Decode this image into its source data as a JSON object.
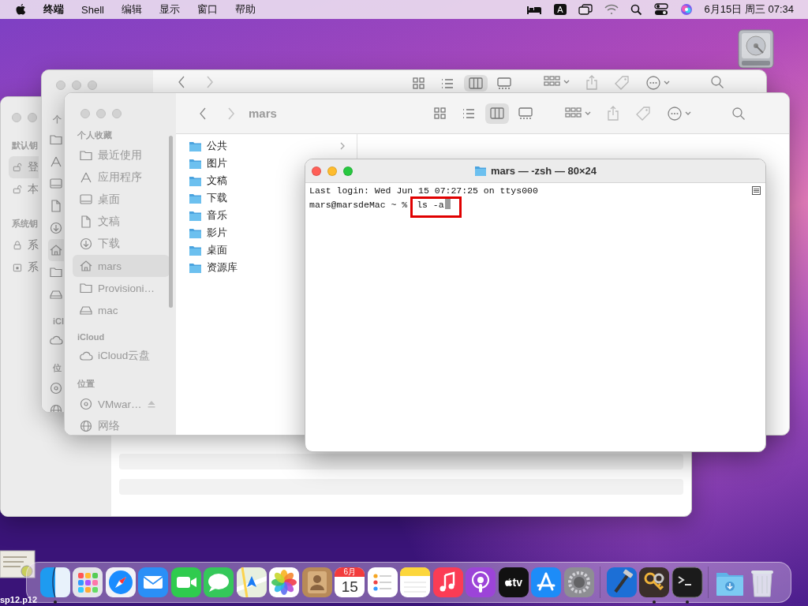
{
  "menu_bar": {
    "app": "终端",
    "menus": [
      "Shell",
      "编辑",
      "显示",
      "窗口",
      "帮助"
    ],
    "input_method": "A",
    "clock": "6月15日 周三 07:34"
  },
  "desktop_icons": [
    {
      "kind": "drive"
    },
    {
      "kind": "certificate",
      "label": "sp12.p12"
    }
  ],
  "keychain_window": {
    "focused": false,
    "sections": [
      {
        "header": "默认钥",
        "items": [
          {
            "kind": "unlocked",
            "label": "登",
            "selected": true
          },
          {
            "kind": "unlocked",
            "label": "本",
            "selected": false
          }
        ]
      },
      {
        "header": "系统钥",
        "items": [
          {
            "kind": "locked",
            "label": "系",
            "selected": false
          },
          {
            "kind": "cabinet",
            "label": "系",
            "selected": false
          }
        ]
      }
    ]
  },
  "back_finder": {
    "focused": false,
    "view_modes": [
      {
        "kind": "icons",
        "selected": false
      },
      {
        "kind": "list",
        "selected": false
      },
      {
        "kind": "columns",
        "selected": true
      },
      {
        "kind": "gallery",
        "selected": false
      }
    ],
    "sidebar": [
      {
        "header": "个",
        "items": [
          {
            "kind": "folder",
            "selected": false
          },
          {
            "kind": "apps",
            "selected": false
          },
          {
            "kind": "desktop",
            "selected": false
          },
          {
            "kind": "doc",
            "selected": false
          },
          {
            "kind": "download",
            "selected": false
          },
          {
            "kind": "home",
            "selected": true
          },
          {
            "kind": "folder",
            "selected": false
          },
          {
            "kind": "drive",
            "selected": false
          }
        ]
      },
      {
        "header": "iCl",
        "items": [
          {
            "kind": "cloud",
            "selected": false
          }
        ]
      },
      {
        "header": "位",
        "items": [
          {
            "kind": "disc",
            "selected": false
          },
          {
            "kind": "globe",
            "selected": false
          }
        ]
      }
    ]
  },
  "finder": {
    "focused": false,
    "title": "mars",
    "view_modes": [
      {
        "kind": "icons",
        "selected": false
      },
      {
        "kind": "list",
        "selected": false
      },
      {
        "kind": "columns",
        "selected": true
      },
      {
        "kind": "gallery",
        "selected": false
      }
    ],
    "sidebar": [
      {
        "header": "个人收藏",
        "items": [
          {
            "kind": "folder",
            "label": "最近使用",
            "selected": false
          },
          {
            "kind": "apps",
            "label": "应用程序",
            "selected": false
          },
          {
            "kind": "desktop",
            "label": "桌面",
            "selected": false
          },
          {
            "kind": "doc",
            "label": "文稿",
            "selected": false
          },
          {
            "kind": "download",
            "label": "下载",
            "selected": false
          },
          {
            "kind": "home",
            "label": "mars",
            "selected": true
          },
          {
            "kind": "folder",
            "label": "Provisioni…",
            "selected": false
          },
          {
            "kind": "drive",
            "label": "mac",
            "selected": false
          }
        ]
      },
      {
        "header": "iCloud",
        "items": [
          {
            "kind": "cloud",
            "label": "iCloud云盘",
            "selected": false
          }
        ]
      },
      {
        "header": "位置",
        "items": [
          {
            "kind": "disc",
            "label": "VMwar…",
            "selected": false,
            "eject": true
          },
          {
            "kind": "globe",
            "label": "网络",
            "selected": false
          }
        ]
      }
    ],
    "column": [
      {
        "label": "公共",
        "has_children": true
      },
      {
        "label": "图片",
        "has_children": false
      },
      {
        "label": "文稿",
        "has_children": false
      },
      {
        "label": "下载",
        "has_children": false
      },
      {
        "label": "音乐",
        "has_children": false
      },
      {
        "label": "影片",
        "has_children": false
      },
      {
        "label": "桌面",
        "has_children": false
      },
      {
        "label": "资源库",
        "has_children": false
      }
    ]
  },
  "terminal": {
    "focused": true,
    "title": "mars — -zsh — 80×24",
    "lines": [
      "Last login: Wed Jun 15 07:27:25 on ttys000"
    ],
    "prompt": "mars@marsdeMac ~ %",
    "command": "ls -a",
    "highlighted": true
  },
  "dock": {
    "apps": [
      {
        "kind": "finder",
        "running": true
      },
      {
        "kind": "launchpad",
        "running": false
      },
      {
        "kind": "safari",
        "running": false
      },
      {
        "kind": "mail",
        "running": false
      },
      {
        "kind": "facetime",
        "running": false
      },
      {
        "kind": "messages",
        "running": false
      },
      {
        "kind": "maps",
        "running": false
      },
      {
        "kind": "photos",
        "running": false
      },
      {
        "kind": "contacts",
        "running": false
      },
      {
        "kind": "calendar",
        "running": false,
        "month": "6月",
        "day": "15"
      },
      {
        "kind": "reminders",
        "running": false
      },
      {
        "kind": "notes",
        "running": false
      },
      {
        "kind": "music",
        "running": false
      },
      {
        "kind": "podcasts",
        "running": false
      },
      {
        "kind": "tv",
        "running": false,
        "label": "tv"
      },
      {
        "kind": "appstore",
        "running": false
      },
      {
        "kind": "settings",
        "running": false
      },
      {
        "kind": "separator"
      },
      {
        "kind": "xcode",
        "running": false
      },
      {
        "kind": "keychain",
        "running": true
      },
      {
        "kind": "terminal",
        "running": true
      },
      {
        "kind": "separator"
      },
      {
        "kind": "downloads",
        "running": false
      },
      {
        "kind": "trash",
        "running": false
      }
    ]
  }
}
